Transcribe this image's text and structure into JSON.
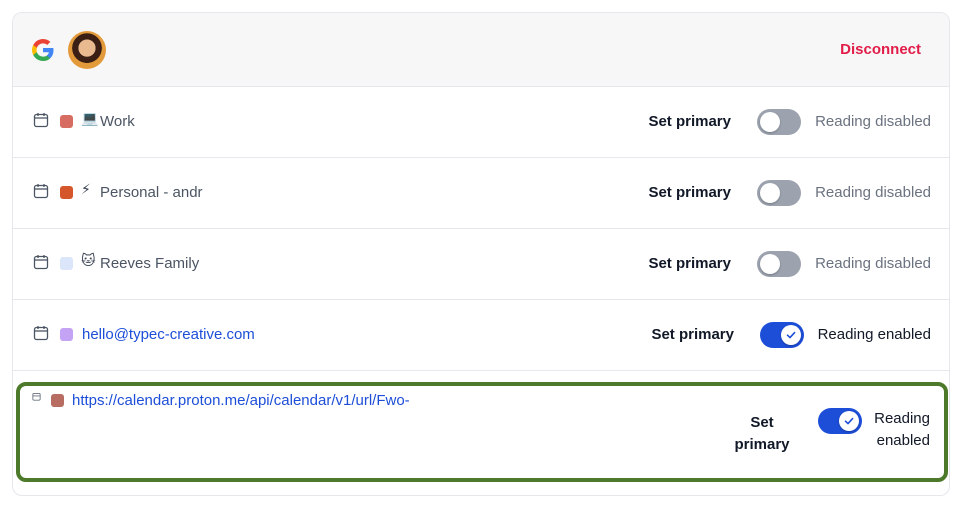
{
  "header": {
    "disconnect_label": "Disconnect",
    "provider_icon": "google-logo",
    "avatar_icon": "user-avatar"
  },
  "calendars": [
    {
      "emoji": "💻",
      "name": "Work",
      "color": "#d76d62",
      "set_primary_label": "Set primary",
      "reading": false,
      "status": "Reading disabled"
    },
    {
      "emoji": "⚡",
      "name": "Personal - andr",
      "color": "#d6562b",
      "set_primary_label": "Set primary",
      "reading": false,
      "status": "Reading disabled"
    },
    {
      "emoji": "🐱",
      "name": "Reeves Family",
      "color": "#dbe6fb",
      "set_primary_label": "Set primary",
      "reading": false,
      "status": "Reading disabled"
    },
    {
      "emoji": "",
      "name": "hello@typec-creative.com",
      "color": "#c4a3f5",
      "set_primary_label": "Set primary",
      "reading": true,
      "status": "Reading enabled"
    },
    {
      "emoji": "",
      "name": "https://calendar.proton.me/api/calendar/v1/url/Fwo-",
      "color": "#b86d62",
      "set_primary_label": "Set primary",
      "reading": true,
      "status": "Reading enabled"
    }
  ],
  "colors": {
    "accent": "#1d4ed8",
    "danger": "#e11d48",
    "highlight_border": "#4d7a2a"
  }
}
